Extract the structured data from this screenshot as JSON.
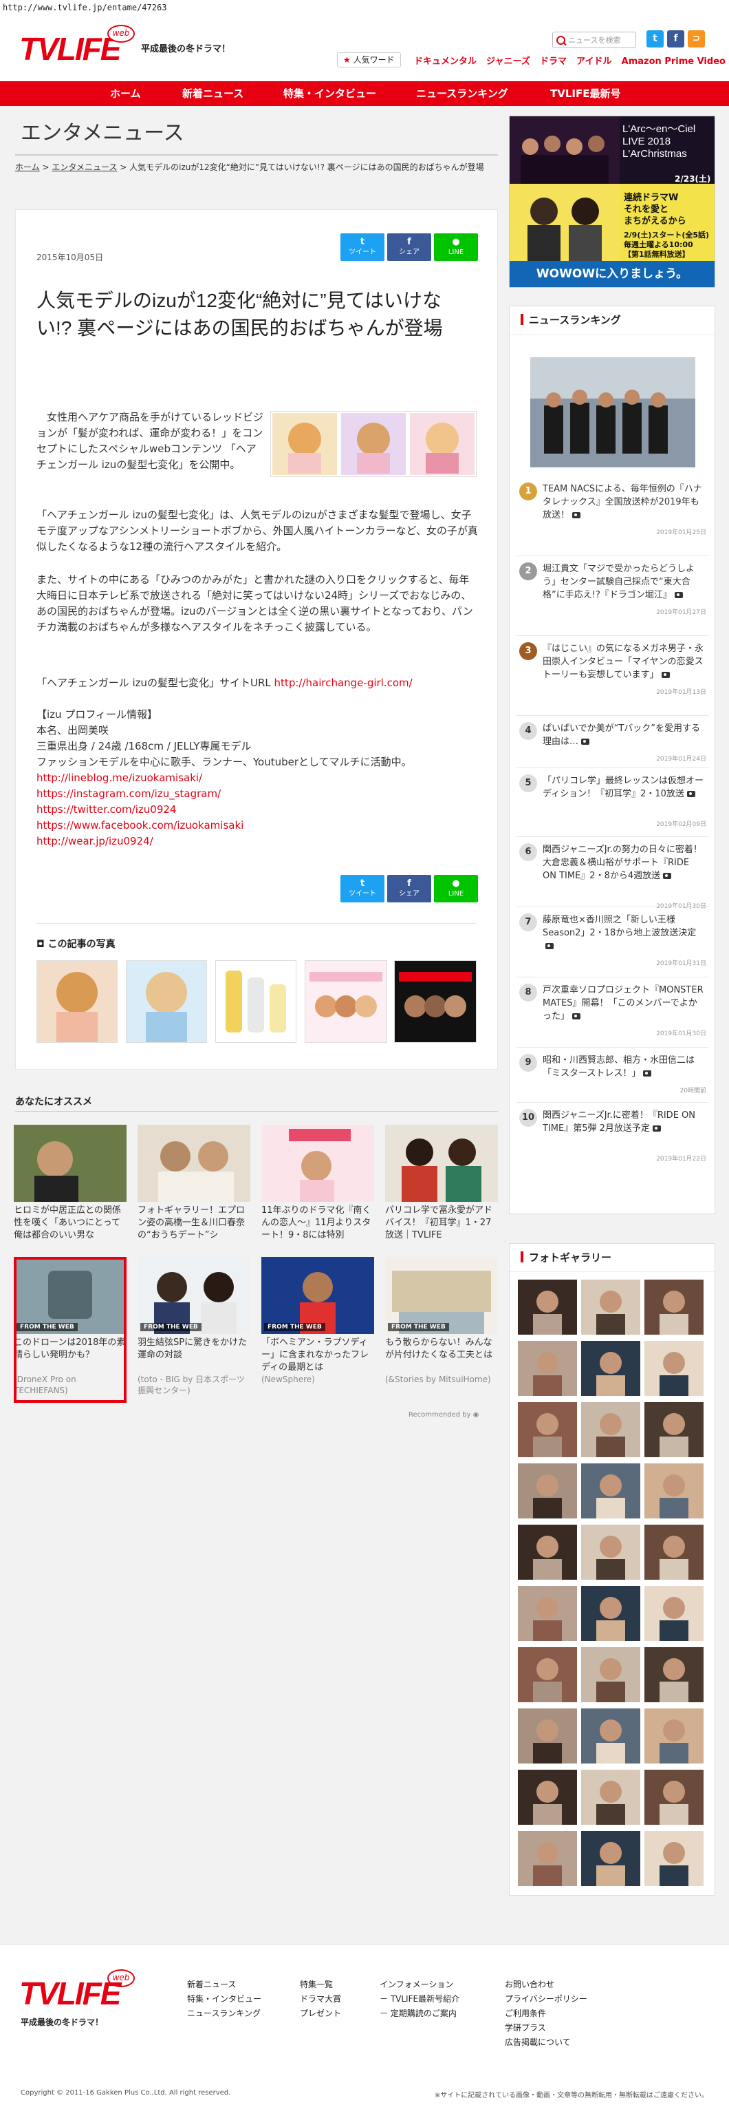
{
  "url": "http://www.tvlife.jp/entame/47263",
  "header": {
    "logo": "TVLIFE",
    "logo_web": "web",
    "tagline": "平成最後の冬ドラマ！",
    "search_placeholder": "ニュースを検索",
    "sns": [
      "t",
      "f",
      "⊃"
    ],
    "hot_label": "人気ワード",
    "hot_words": [
      "ドキュメンタル",
      "ジャニーズ",
      "ドラマ",
      "アイドル",
      "Amazon Prime Video"
    ]
  },
  "nav": [
    "ホーム",
    "新着ニュース",
    "特集・インタビュー",
    "ニュースランキング",
    "TVLIFE最新号"
  ],
  "section_title": "エンタメニュース",
  "breadcrumb": {
    "home": "ホーム",
    "sep": ">",
    "cat": "エンタメニュース",
    "current": "人気モデルのizuが12変化“絶対に”見てはいけない!? 裏ページにはあの国民的おばちゃんが登場"
  },
  "article": {
    "date": "2015年10月05日",
    "share": {
      "tweet": "ツイート",
      "fb": "シェア",
      "line": "LINE",
      "tw_icon": "t",
      "fb_icon": "f",
      "line_icon": "●"
    },
    "title": "人気モデルのizuが12変化“絶対に”見てはいけない!? 裏ページにはあの国民的おばちゃんが登場",
    "p1": "　女性用ヘアケア商品を手がけているレッドビジョンが「髪が変われば、運命が変わる！」をコンセプトにしたスペシャルwebコンテンツ 「ヘアチェンガール izuの髪型七変化」を公開中。",
    "p2": "「ヘアチェンガール izuの髪型七変化」は、人気モデルのizuがさまざまな髪型で登場し、女子モテ度アップなアシンメトリーショートボブから、外国人風ハイトーンカラーなど、女の子が真似したくなるような12種の流行ヘアスタイルを紹介。",
    "p3": "また、サイトの中にある「ひみつのかみがた」と書かれた謎の入り口をクリックすると、毎年大晦日に日本テレビ系で放送される「絶対に笑ってはいけない24時」シリーズでおなじみの、あの国民的おばちゃんが登場。izuのバージョンとは全く逆の黒い裏サイトとなっており、パンチカ満載のおばちゃんが多様なヘアスタイルをネチっこく披露している。",
    "p4_label": "「ヘアチェンガール izuの髪型七変化」サイトURL ",
    "p4_link": "http://hairchange-girl.com/",
    "profile_head": "【izu プロフィール情報】",
    "profile_lines": [
      "本名、出岡美咲",
      "三重県出身 / 24歳 /168cm / JELLY専属モデル",
      "ファッションモデルを中心に歌手、ランナー、Youtuberとしてマルチに活動中。"
    ],
    "profile_links": [
      "http://lineblog.me/izuokamisaki/",
      "https://instagram.com/izu_stagram/",
      "https://twitter.com/izu0924",
      "https://www.facebook.com/izuokamisaki",
      "http://wear.jp/izu0924/"
    ],
    "photos_title": "この記事の写真"
  },
  "recommend": {
    "title": "あなたにオススメ",
    "ftw_label": "FROM THE WEB",
    "cards": [
      {
        "text": "ヒロミが中居正広との関係性を嘆く「あいつにとって俺は都合のいい男な",
        "src": ""
      },
      {
        "text": "フォトギャラリー！エプロン姿の高橋一生＆川口春奈の“おうちデート”シ",
        "src": ""
      },
      {
        "text": "11年ぶりのドラマ化『南くんの恋人〜』11月よりスタート！9・8には特別",
        "src": ""
      },
      {
        "text": "パリコレ学で冨永愛がアドバイス！『初耳学』1・27放送｜TVLIFE",
        "src": ""
      },
      {
        "text": "このドローンは2018年の素晴らしい発明かも？",
        "src": "(DroneX Pro on TECHIEFANS)"
      },
      {
        "text": "羽生結弦SPに驚きをかけた運命の対談",
        "src": "(toto - BIG by 日本スポーツ振興センター)"
      },
      {
        "text": "「ボヘミアン・ラプソディー」に含まれなかったフレディの最期とは",
        "src": "(NewSphere)"
      },
      {
        "text": "もう散らからない！みんなが片付けたくなる工夫とは",
        "src": "(&Stories by MitsuiHome)"
      }
    ],
    "recommended_by": "Recommended by"
  },
  "ad": {
    "l1": "L'Arc〜en〜Ciel",
    "l2": "LIVE 2018",
    "l3": "L'ArChristmas",
    "date1": "2/23(土)",
    "l4": "連続ドラマW",
    "l5": "それを愛と",
    "l6": "まちがえるから",
    "date2": "2/9(土)スタート(全5話)",
    "l7": "毎週土曜よる10:00",
    "l8": "【第1話無料放送】",
    "cta": "WOWOWに入りましょう。"
  },
  "ranking": {
    "title": "ニュースランキング",
    "items": [
      {
        "num": "1",
        "text": "TEAM NACSによる、毎年恒例の『ハナタレナックス』全国放送枠が2019年も放送！",
        "cam": true,
        "date": "2019年01月25日"
      },
      {
        "num": "2",
        "text": "堀江貴文「マジで受かったらどうしよう」センター試験自己採点で“東大合格”に手応え!?『ドラゴン堀江』",
        "cam": true,
        "date": "2019年01月27日"
      },
      {
        "num": "3",
        "text": "『はじこい』の気になるメガネ男子・永田崇人インタビュー「マイヤンの恋愛ストーリーも妄想しています」",
        "cam": true,
        "date": "2019年01月13日"
      },
      {
        "num": "4",
        "text": "ぱいぱいでか美が“Tバック”を愛用する理由は…",
        "cam": true,
        "date": "2019年01月24日"
      },
      {
        "num": "5",
        "text": "「パリコレ学」最終レッスンは仮想オーディション！『初耳学』2・10放送",
        "cam": true,
        "date": "2019年02月09日"
      },
      {
        "num": "6",
        "text": "関西ジャニーズJr.の努力の日々に密着！大倉忠義＆横山裕がサポート『RIDE ON TIME』2・8から4週放送",
        "cam": true,
        "date": "2019年01月30日"
      },
      {
        "num": "7",
        "text": "藤原竜也×香川照之「新しい王様Season2」2・18から地上波放送決定",
        "cam": true,
        "date": "2019年01月31日"
      },
      {
        "num": "8",
        "text": "戸次重幸ソロプロジェクト『MONSTER MATES』開幕！「このメンバーでよかった」",
        "cam": true,
        "date": "2019年01月30日"
      },
      {
        "num": "9",
        "text": "昭和・川西賢志郎、相方・水田信二は「ミスターストレス！」",
        "cam": true,
        "date": "20時間前"
      },
      {
        "num": "10",
        "text": "関西ジャニーズJr.に密着！『RIDE ON TIME』第5弾 2月放送予定",
        "cam": true,
        "date": "2019年01月22日"
      }
    ]
  },
  "gallery": {
    "title": "フォトギャラリー"
  },
  "footer": {
    "logo": "TVLIFE",
    "web": "web",
    "tagline": "平成最後の冬ドラマ！",
    "col1": [
      "新着ニュース",
      "特集・インタビュー",
      "ニュースランキング"
    ],
    "col2": [
      "特集一覧",
      "ドラマ大賞",
      "プレゼント"
    ],
    "col3": [
      "インフォメーション",
      "－ TVLIFE最新号紹介",
      "－ 定期購読のご案内"
    ],
    "col4": [
      "お問い合わせ",
      "プライバシーポリシー",
      "ご利用条件",
      "学研プラス",
      "広告掲載について"
    ],
    "copyright": "Copyright © 2011-16 Gakken Plus Co.,Ltd. All right reserved.",
    "note": "※サイトに記載されている画像・動画・文章等の無断転用・無断転載はご遠慮ください。"
  }
}
